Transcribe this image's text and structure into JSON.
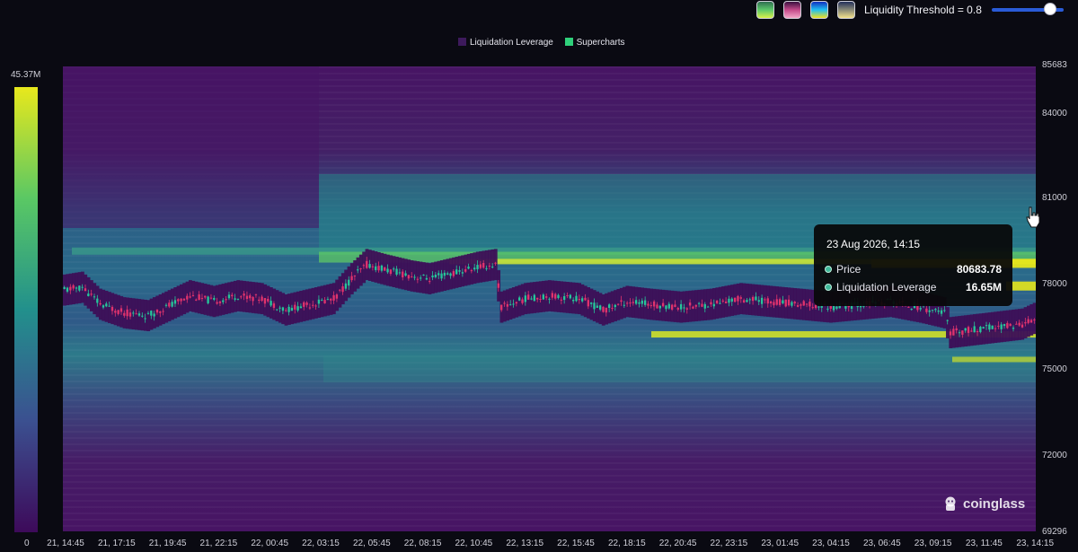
{
  "toolbar": {
    "color_schemes": [
      {
        "name": "viridis-scheme-button",
        "colors": [
          "#2f6f52",
          "#5cc86a",
          "#d8f04a"
        ]
      },
      {
        "name": "magma-scheme-button",
        "colors": [
          "#3a1040",
          "#c44a8a",
          "#f3a6c8"
        ]
      },
      {
        "name": "rainbow-scheme-button",
        "colors": [
          "#1030c0",
          "#20c0f0",
          "#f0e020"
        ]
      },
      {
        "name": "cividis-scheme-button",
        "colors": [
          "#24305a",
          "#8a8a78",
          "#f2e08a"
        ]
      }
    ],
    "threshold_label": "Liquidity Threshold = 0.8",
    "threshold_value": 0.8
  },
  "colors": {
    "low": "#471464",
    "mid": "#23908c",
    "high": "#e4e61c",
    "candle_up": "#26c69a",
    "candle_down": "#e0336d",
    "price_band": "#3d0f57"
  },
  "chart_data": {
    "type": "heatmap",
    "title": "",
    "legend": [
      {
        "label": "Liquidation Leverage",
        "color": "#3d1a5c"
      },
      {
        "label": "Supercharts",
        "color": "#2fd07a"
      }
    ],
    "colorbar": {
      "min_label": "0",
      "max_label": "45.37M",
      "min": 0,
      "max": 45370000
    },
    "y_ticks": [
      "85683",
      "84000",
      "81000",
      "78000",
      "75000",
      "72000",
      "69296"
    ],
    "y_range": [
      69296,
      85683
    ],
    "x_ticks": [
      "21, 14:45",
      "21, 17:15",
      "21, 19:45",
      "21, 22:15",
      "22, 00:45",
      "22, 03:15",
      "22, 05:45",
      "22, 08:15",
      "22, 10:45",
      "22, 13:15",
      "22, 15:45",
      "22, 18:15",
      "22, 20:45",
      "22, 23:15",
      "23, 01:45",
      "23, 04:15",
      "23, 06:45",
      "23, 09:15",
      "23, 11:45",
      "23, 14:15"
    ],
    "price_path": [
      {
        "x": 0,
        "p": 77800
      },
      {
        "x": 6,
        "p": 77900
      },
      {
        "x": 12,
        "p": 77300
      },
      {
        "x": 20,
        "p": 77000
      },
      {
        "x": 28,
        "p": 76900
      },
      {
        "x": 34,
        "p": 77200
      },
      {
        "x": 42,
        "p": 77600
      },
      {
        "x": 50,
        "p": 77400
      },
      {
        "x": 58,
        "p": 77600
      },
      {
        "x": 66,
        "p": 77500
      },
      {
        "x": 74,
        "p": 77100
      },
      {
        "x": 82,
        "p": 77300
      },
      {
        "x": 90,
        "p": 77500
      },
      {
        "x": 96,
        "p": 78200
      },
      {
        "x": 101,
        "p": 78700
      },
      {
        "x": 108,
        "p": 78500
      },
      {
        "x": 116,
        "p": 78300
      },
      {
        "x": 122,
        "p": 78200
      },
      {
        "x": 130,
        "p": 78400
      },
      {
        "x": 138,
        "p": 78600
      },
      {
        "x": 144,
        "p": 78700
      },
      {
        "x": 146,
        "p": 77200
      },
      {
        "x": 154,
        "p": 77500
      },
      {
        "x": 162,
        "p": 77600
      },
      {
        "x": 172,
        "p": 77500
      },
      {
        "x": 180,
        "p": 77100
      },
      {
        "x": 188,
        "p": 77400
      },
      {
        "x": 196,
        "p": 77300
      },
      {
        "x": 206,
        "p": 77200
      },
      {
        "x": 216,
        "p": 77300
      },
      {
        "x": 226,
        "p": 77500
      },
      {
        "x": 236,
        "p": 77400
      },
      {
        "x": 246,
        "p": 77300
      },
      {
        "x": 256,
        "p": 77200
      },
      {
        "x": 266,
        "p": 77300
      },
      {
        "x": 276,
        "p": 77400
      },
      {
        "x": 286,
        "p": 77200
      },
      {
        "x": 294,
        "p": 77000
      },
      {
        "x": 296,
        "p": 76300
      },
      {
        "x": 304,
        "p": 76400
      },
      {
        "x": 312,
        "p": 76500
      },
      {
        "x": 320,
        "p": 76600
      },
      {
        "x": 324,
        "p": 76800
      }
    ],
    "tooltip": {
      "title": "23 Aug 2026, 14:15",
      "rows": [
        {
          "label": "Price",
          "value": "80683.78"
        },
        {
          "label": "Liquidation Leverage",
          "value": "16.65M"
        }
      ]
    }
  },
  "watermark": "coinglass"
}
